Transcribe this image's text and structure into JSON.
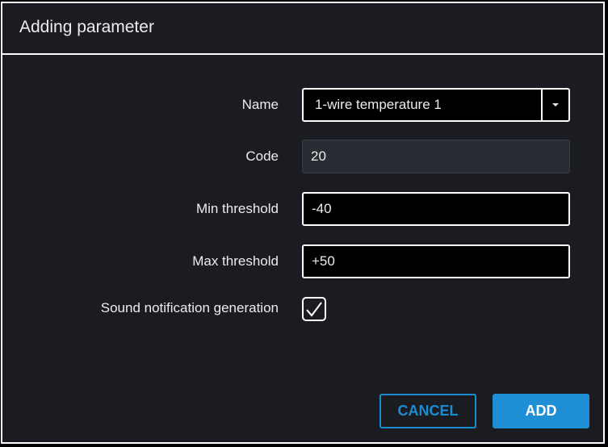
{
  "dialog": {
    "title": "Adding parameter",
    "fields": {
      "name": {
        "label": "Name",
        "value": "1-wire temperature 1"
      },
      "code": {
        "label": "Code",
        "value": "20"
      },
      "min_threshold": {
        "label": "Min threshold",
        "value": "-40"
      },
      "max_threshold": {
        "label": "Max threshold",
        "value": "+50"
      },
      "sound_notification": {
        "label": "Sound notification generation",
        "checked": true
      }
    },
    "buttons": {
      "cancel": "CANCEL",
      "add": "ADD"
    },
    "colors": {
      "accent": "#1e8fd4",
      "background": "#1b1c21"
    }
  }
}
